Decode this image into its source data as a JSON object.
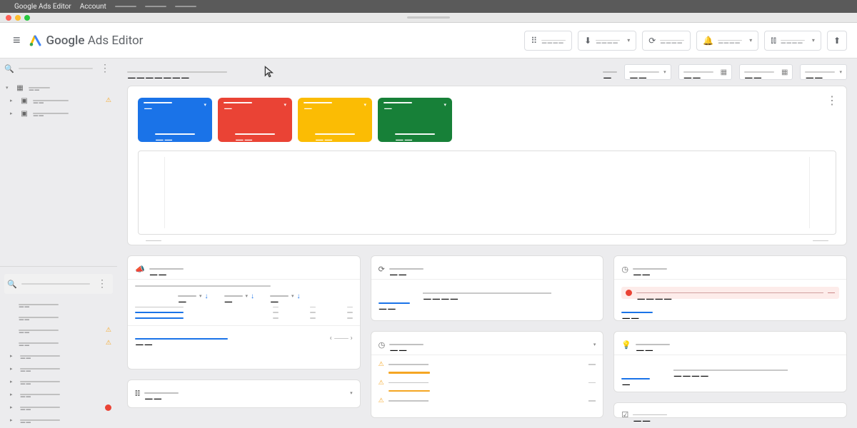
{
  "os_menu": {
    "app": "Google Ads Editor",
    "account": "Account"
  },
  "app_title": {
    "brand": "Google",
    "product": "Ads Editor"
  },
  "toolbar": {
    "grid_label": "————",
    "download_label": "————",
    "refresh_label": "————",
    "notify_label": "————",
    "stats_label": "————",
    "upload_label": "————"
  },
  "sidebar": {
    "top_search_placeholder": "",
    "root": {
      "label": "——"
    },
    "items": [
      {
        "label": "——",
        "status": "warn"
      },
      {
        "label": "——",
        "status": ""
      }
    ],
    "nav_search_placeholder": "",
    "nav": [
      {
        "label": "——"
      },
      {
        "label": "——"
      },
      {
        "label": "——",
        "status": "warn"
      },
      {
        "label": "——",
        "status": "warn"
      },
      {
        "label": "——"
      },
      {
        "label": "——"
      },
      {
        "label": "——"
      },
      {
        "label": "——"
      },
      {
        "label": "——",
        "status": "error"
      },
      {
        "label": "——"
      }
    ]
  },
  "filters": {
    "crumb": "———————",
    "small": "—",
    "f1": "——",
    "f2": "——",
    "f3": "——",
    "f4": "——"
  },
  "metrics": [
    {
      "color": "blue",
      "label": "—",
      "value": "——"
    },
    {
      "color": "red",
      "label": "—",
      "value": "——"
    },
    {
      "color": "yellow",
      "label": "—",
      "value": "——"
    },
    {
      "color": "green",
      "label": "—",
      "value": "——"
    }
  ],
  "chart_data": {
    "type": "line",
    "title": "",
    "xlabel": "",
    "ylabel": "",
    "x": [],
    "series": [],
    "note": "chart area is empty (no plotted data visible)"
  },
  "cards": {
    "campaigns": {
      "icon": "megaphone",
      "title": "——",
      "cols": [
        "—",
        "—",
        "—"
      ],
      "rows": 3,
      "pager": "——"
    },
    "sync": {
      "icon": "sync",
      "title": "——",
      "body": "————",
      "action": "——"
    },
    "time": {
      "icon": "clock",
      "title": "——",
      "alert": "————",
      "action": "——"
    },
    "history": {
      "icon": "history",
      "title": "——",
      "items": 3
    },
    "tips": {
      "icon": "bulb",
      "title": "——",
      "body": "————",
      "action": "—"
    },
    "stats": {
      "icon": "bar",
      "title": "——"
    },
    "check": {
      "icon": "check",
      "title": "——"
    }
  }
}
